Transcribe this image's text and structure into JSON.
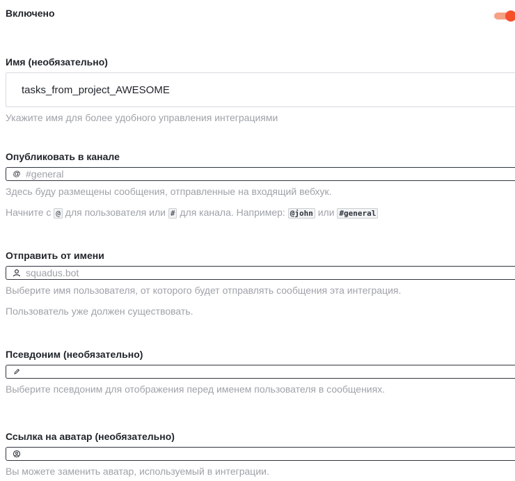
{
  "enabled": {
    "label": "Включено",
    "toggle_on": true,
    "accent_color": "#f5502c"
  },
  "name": {
    "label": "Имя (необязательно)",
    "value": "tasks_from_project_AWESOME",
    "hint": "Укажите имя для более удобного управления интеграциями"
  },
  "channel": {
    "label": "Опубликовать в канале",
    "prefix_icon": "at-icon",
    "prefix_glyph": "@",
    "placeholder": "#general",
    "hint1": "Здесь буду размещены сообщения, отправленные на входящий вебхук.",
    "hint2_parts": {
      "t1": "Начните с ",
      "c1": "@",
      "t2": " для пользователя или ",
      "c2": "#",
      "t3": " для канала. Например: ",
      "c3": "@john",
      "t4": " или ",
      "c4": "#general"
    }
  },
  "post_as": {
    "label": "Отправить от имени",
    "prefix_icon": "user-icon",
    "placeholder": "squadus.bot",
    "hint1": "Выберите имя пользователя, от которого будет отправлять сообщения эта интеграция.",
    "hint2": "Пользователь уже должен существовать."
  },
  "alias": {
    "label": "Псевдоним (необязательно)",
    "prefix_icon": "pencil-icon",
    "placeholder": "",
    "hint": "Выберите псевдоним для отображения перед именем пользователя в сообщениях."
  },
  "avatar": {
    "label": "Ссылка на аватар (необязательно)",
    "prefix_icon": "avatar-icon",
    "placeholder": "",
    "hint": "Вы можете заменить аватар, используемый в интеграции."
  }
}
